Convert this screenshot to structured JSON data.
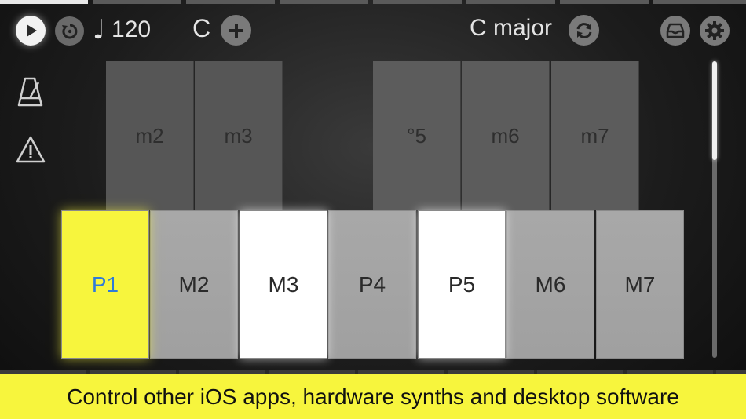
{
  "toolbar": {
    "tempo": "120",
    "note_glyph": "♩",
    "key_root": "C",
    "scale_name": "C major"
  },
  "icons": {
    "play": "play-icon",
    "loop": "loop-icon",
    "add": "plus-icon",
    "refresh": "refresh-icon",
    "tray": "tray-icon",
    "settings": "gear-icon",
    "metronome": "metronome-icon",
    "warning": "warning-icon"
  },
  "pads": {
    "top": [
      {
        "label": "m2"
      },
      {
        "label": "m3"
      },
      {
        "label": "°5"
      },
      {
        "label": "m6"
      },
      {
        "label": "m7"
      }
    ],
    "bottom": [
      {
        "label": "P1",
        "state": "yellow"
      },
      {
        "label": "M2",
        "state": "grey"
      },
      {
        "label": "M3",
        "state": "white"
      },
      {
        "label": "P4",
        "state": "grey"
      },
      {
        "label": "P5",
        "state": "white"
      },
      {
        "label": "M6",
        "state": "grey"
      },
      {
        "label": "M7",
        "state": "grey"
      }
    ]
  },
  "banner": {
    "text": "Control other iOS apps, hardware synths and desktop software"
  },
  "colors": {
    "accent_yellow": "#f7f53d",
    "label_blue": "#2f7bd8"
  }
}
